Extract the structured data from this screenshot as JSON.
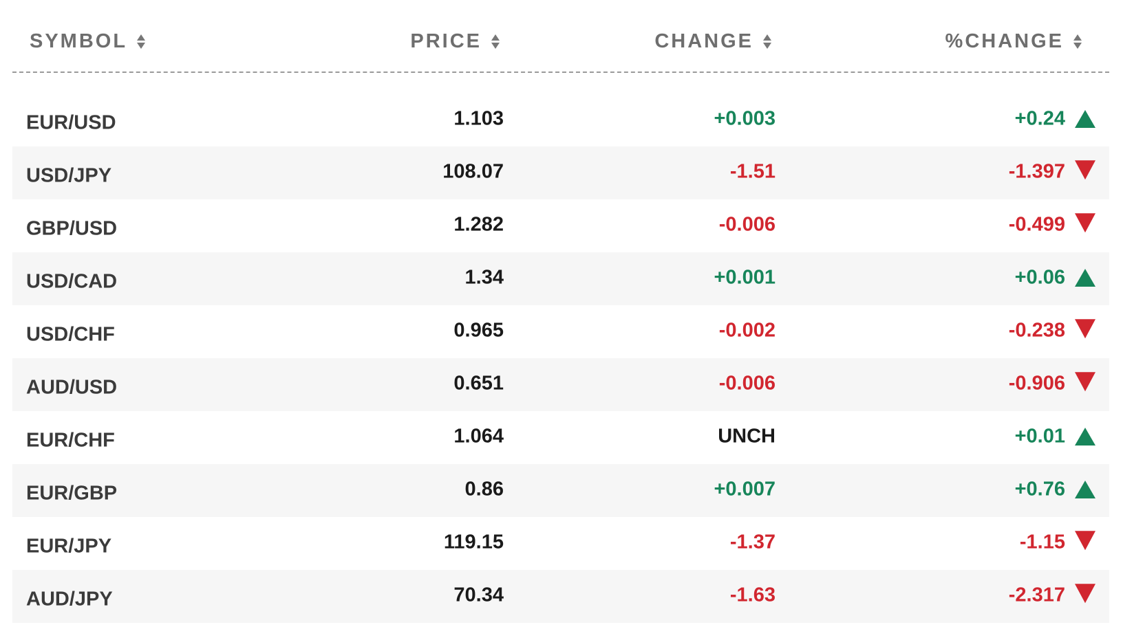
{
  "colors": {
    "positive": "#17855a",
    "negative": "#d1262f",
    "header_text": "#6e6e6e",
    "row_alt_bg": "#f6f6f6"
  },
  "table": {
    "headers": {
      "symbol": "SYMBOL",
      "price": "PRICE",
      "change": "CHANGE",
      "pct_change": "%CHANGE"
    },
    "rows": [
      {
        "symbol": "EUR/USD",
        "price": "1.103",
        "change": "+0.003",
        "pct_change": "+0.24",
        "direction": "up",
        "change_direction": "up"
      },
      {
        "symbol": "USD/JPY",
        "price": "108.07",
        "change": "-1.51",
        "pct_change": "-1.397",
        "direction": "down",
        "change_direction": "down"
      },
      {
        "symbol": "GBP/USD",
        "price": "1.282",
        "change": "-0.006",
        "pct_change": "-0.499",
        "direction": "down",
        "change_direction": "down"
      },
      {
        "symbol": "USD/CAD",
        "price": "1.34",
        "change": "+0.001",
        "pct_change": "+0.06",
        "direction": "up",
        "change_direction": "up"
      },
      {
        "symbol": "USD/CHF",
        "price": "0.965",
        "change": "-0.002",
        "pct_change": "-0.238",
        "direction": "down",
        "change_direction": "down"
      },
      {
        "symbol": "AUD/USD",
        "price": "0.651",
        "change": "-0.006",
        "pct_change": "-0.906",
        "direction": "down",
        "change_direction": "down"
      },
      {
        "symbol": "EUR/CHF",
        "price": "1.064",
        "change": "UNCH",
        "pct_change": "+0.01",
        "direction": "up",
        "change_direction": "flat"
      },
      {
        "symbol": "EUR/GBP",
        "price": "0.86",
        "change": "+0.007",
        "pct_change": "+0.76",
        "direction": "up",
        "change_direction": "up"
      },
      {
        "symbol": "EUR/JPY",
        "price": "119.15",
        "change": "-1.37",
        "pct_change": "-1.15",
        "direction": "down",
        "change_direction": "down"
      },
      {
        "symbol": "AUD/JPY",
        "price": "70.34",
        "change": "-1.63",
        "pct_change": "-2.317",
        "direction": "down",
        "change_direction": "down"
      }
    ]
  }
}
